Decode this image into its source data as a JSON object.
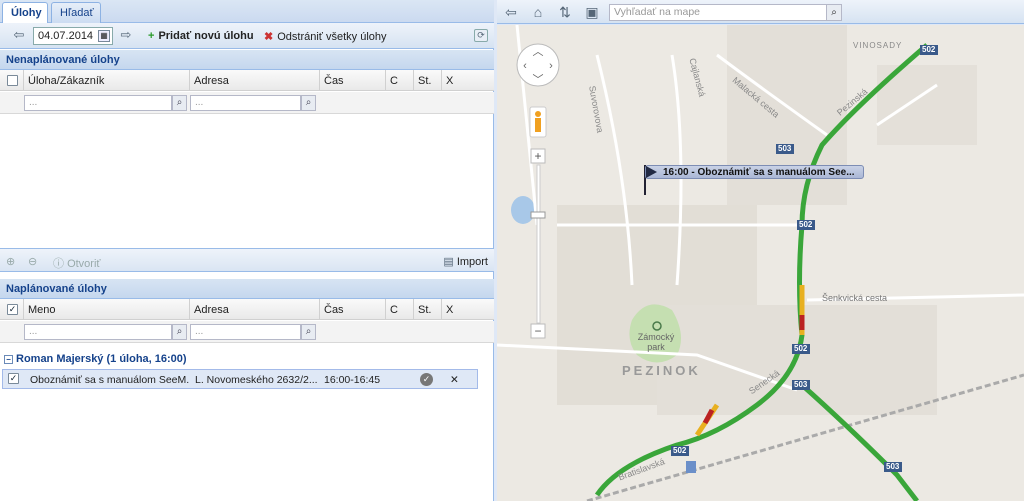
{
  "tabs": [
    {
      "label": "Úlohy",
      "active": true
    },
    {
      "label": "Hľadať",
      "active": false
    }
  ],
  "toolbar": {
    "date": "04.07.2014",
    "add_task": "Pridať novú úlohu",
    "remove_all": "Odstrániť všetky úlohy"
  },
  "unplanned": {
    "title": "Nenaplánované úlohy",
    "columns": [
      "Úloha/Zákazník",
      "Adresa",
      "Čas",
      "C",
      "St.",
      "X"
    ],
    "filter_placeholder_1": "...",
    "filter_placeholder_2": "..."
  },
  "mid_toolbar": {
    "open": "Otvoriť",
    "import": "Import"
  },
  "planned": {
    "title": "Naplánované úlohy",
    "columns": [
      "Meno",
      "Adresa",
      "Čas",
      "C",
      "St.",
      "X"
    ],
    "filter_placeholder_1": "...",
    "filter_placeholder_2": "...",
    "group": "Roman Majerský (1 úloha, 16:00)",
    "rows": [
      {
        "name": "Oboznámiť sa s manuálom SeeM...",
        "address": "L. Novomeského 2632/2...",
        "time": "16:00-16:45",
        "close": "✕"
      }
    ]
  },
  "map": {
    "search_placeholder": "Vyhľadať na mape",
    "task_label": "16:00 - Oboznámiť sa s manuálom See...",
    "labels": {
      "town": "PEZINOK",
      "park": "Zámocký park",
      "vinosady": "VINOSADY",
      "suvorovova": "Suvorovova",
      "cajlanska": "Cajlanská",
      "malacka": "Malacká cesta",
      "pezinska": "Pezinská",
      "senkvicka": "Šenkvická cesta",
      "senecka": "Senecká",
      "bratislavska": "Bratislavská"
    },
    "road_numbers": {
      "r502": "502",
      "r503": "503"
    }
  }
}
